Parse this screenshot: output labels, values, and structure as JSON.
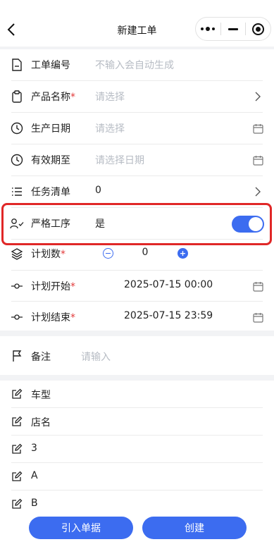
{
  "nav": {
    "title": "新建工单",
    "back_icon": "chevron-left-icon",
    "more_icon": "more-dots-icon",
    "minimize_icon": "minimize-icon",
    "close_icon": "target-icon"
  },
  "form": {
    "order_no": {
      "label": "工单编号",
      "placeholder": "不输入会自动生成"
    },
    "product": {
      "label": "产品名称",
      "placeholder": "请选择"
    },
    "production_date": {
      "label": "生产日期",
      "placeholder": "请选择"
    },
    "expiry": {
      "label": "有效期至",
      "placeholder": "请选择日期"
    },
    "task_list": {
      "label": "任务清单",
      "value": "0"
    },
    "strict_process": {
      "label": "严格工序",
      "value": "是",
      "enabled": true
    },
    "plan_qty": {
      "label": "计划数",
      "value": "0"
    },
    "plan_start": {
      "label": "计划开始",
      "value": "2025-07-15 00:00"
    },
    "plan_end": {
      "label": "计划结束",
      "value": "2025-07-15 23:59"
    },
    "required_mark": "*"
  },
  "remark": {
    "label": "备注",
    "placeholder": "请输入"
  },
  "custom_fields": [
    {
      "label": "车型"
    },
    {
      "label": "店名"
    },
    {
      "label": "3"
    },
    {
      "label": "A"
    },
    {
      "label": "B"
    }
  ],
  "footer": {
    "import_label": "引入单据",
    "create_label": "创建"
  },
  "colors": {
    "primary": "#3c6cf0",
    "required": "#e23b3b",
    "highlight": "#e02727",
    "placeholder": "#b7bcc4"
  }
}
